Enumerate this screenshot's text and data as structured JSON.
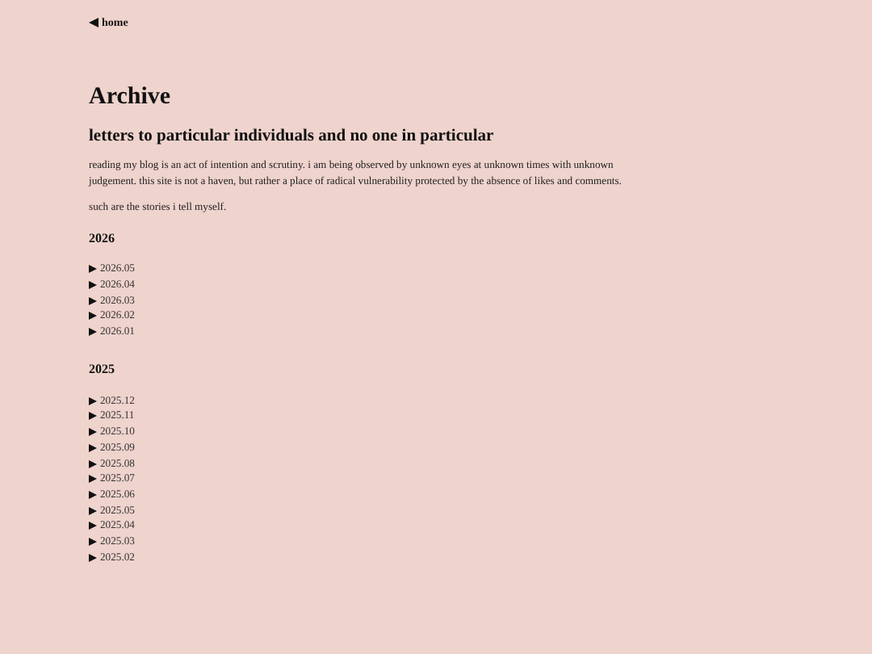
{
  "nav": {
    "home_link": "home"
  },
  "title": "Archive",
  "subtitle": "letters to particular individuals and no one in particular",
  "paragraphs": [
    "reading my blog is an act of intention and scrutiny. i am being observed by unknown eyes at unknown times with unknown judgement. this site is not a haven, but rather a place of radical vulnerability protected by the absence of likes and comments.",
    "such are the stories i tell myself."
  ],
  "years": [
    {
      "year": "2026",
      "months": [
        {
          "label": "2026.05",
          "expanded": false
        },
        {
          "label": "2026.04",
          "expanded": false
        },
        {
          "label": "2026.03",
          "expanded": false
        },
        {
          "label": "2026.02",
          "expanded": false
        },
        {
          "label": "2026.01",
          "expanded": false
        }
      ]
    },
    {
      "year": "2025",
      "months": [
        {
          "label": "2025.12",
          "expanded": false
        },
        {
          "label": "2025.11",
          "expanded": false
        },
        {
          "label": "2025.10",
          "expanded": false
        },
        {
          "label": "2025.09",
          "expanded": false
        },
        {
          "label": "2025.08",
          "expanded": false
        },
        {
          "label": "2025.07",
          "expanded": false
        },
        {
          "label": "2025.06",
          "expanded": false
        },
        {
          "label": "2025.05",
          "expanded": false
        },
        {
          "label": "2025.04",
          "expanded": false
        },
        {
          "label": "2025.03",
          "expanded": false
        },
        {
          "label": "2025.02",
          "expanded": false
        }
      ]
    }
  ]
}
